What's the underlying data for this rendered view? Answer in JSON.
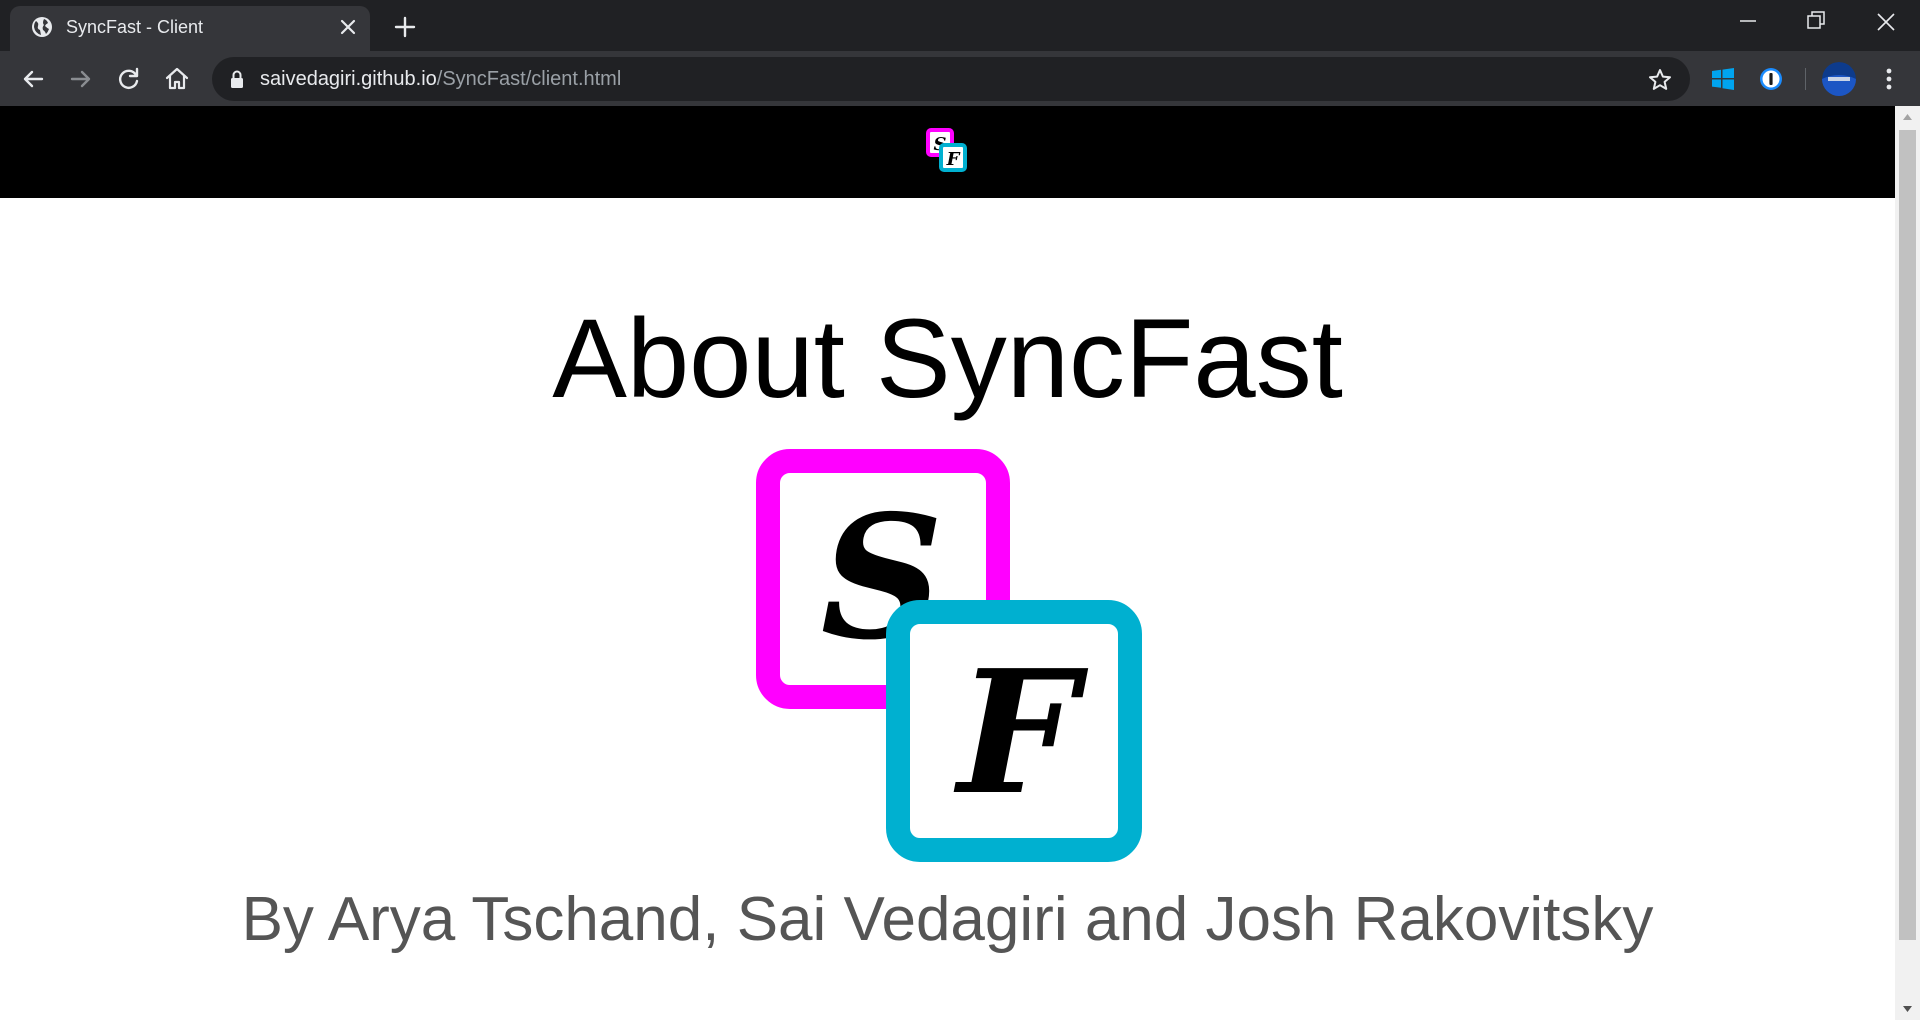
{
  "browser": {
    "tab": {
      "title": "SyncFast - Client",
      "favicon": "globe-icon"
    },
    "new_tab_icon": "plus-icon",
    "window_controls": [
      "minimize-icon",
      "restore-icon",
      "close-icon"
    ],
    "address": {
      "host": "saivedagiri.github.io",
      "path": "/SyncFast/client.html",
      "secure_icon": "lock-icon"
    },
    "extensions": [
      "windows-icon",
      "password-manager-icon"
    ],
    "profile": "avatar",
    "menu_icon": "kebab-menu-icon",
    "dark_bg": "#202124",
    "tab_bg": "#35363a"
  },
  "site": {
    "header": {
      "logo_letters": [
        "S",
        "F"
      ]
    },
    "title": "About SyncFast",
    "logo": {
      "letter_top": "S",
      "letter_bottom": "F",
      "color_top": "#ff00ff",
      "color_bottom": "#00b0d0"
    },
    "authors": "By Arya Tschand, Sai Vedagiri and Josh Rakovitsky"
  }
}
